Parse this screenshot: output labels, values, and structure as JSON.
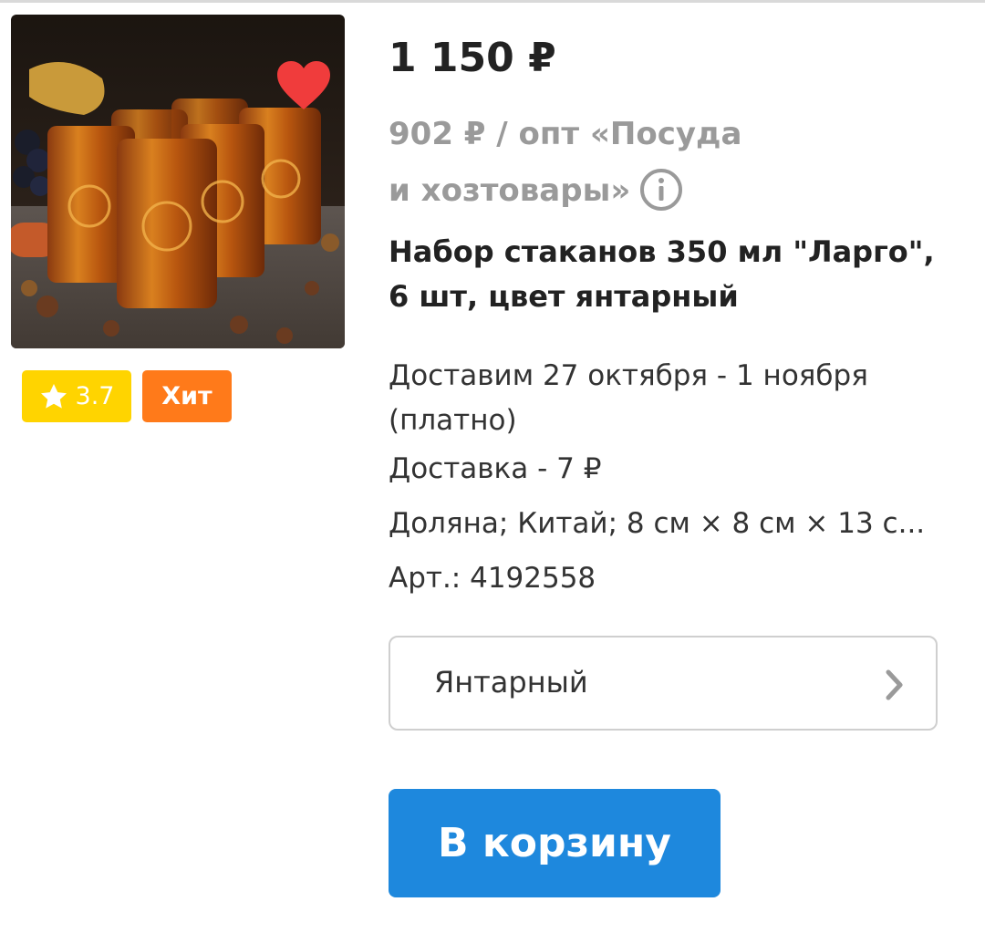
{
  "product": {
    "image_alt": "Набор янтарных стаканов",
    "favorite": true,
    "price": "1 150 ₽",
    "opt_price": "902 ₽ / опт «Посуда и хозтовары»",
    "title": "Набор стаканов 350 мл \"Ларго\", 6 шт, цвет янтарный",
    "delivery": "Доставим 27 октября - 1 ноября (платно)",
    "delivery_cost": "Доставка - 7 ₽",
    "specs": "Доляна; Китай; 8 см × 8 см × 13 с...",
    "article": "Арт.: 4192558",
    "rating": "3.7",
    "hit_label": "Хит",
    "variant": "Янтарный",
    "cart_button": "В корзину"
  },
  "colors": {
    "accent_button": "#1e88dd",
    "rating_badge": "#ffd400",
    "hit_badge": "#ff7a1a",
    "favorite_heart": "#f03c3c"
  },
  "icons": [
    "heart-icon",
    "star-icon",
    "info-icon",
    "chevron-right-icon"
  ]
}
